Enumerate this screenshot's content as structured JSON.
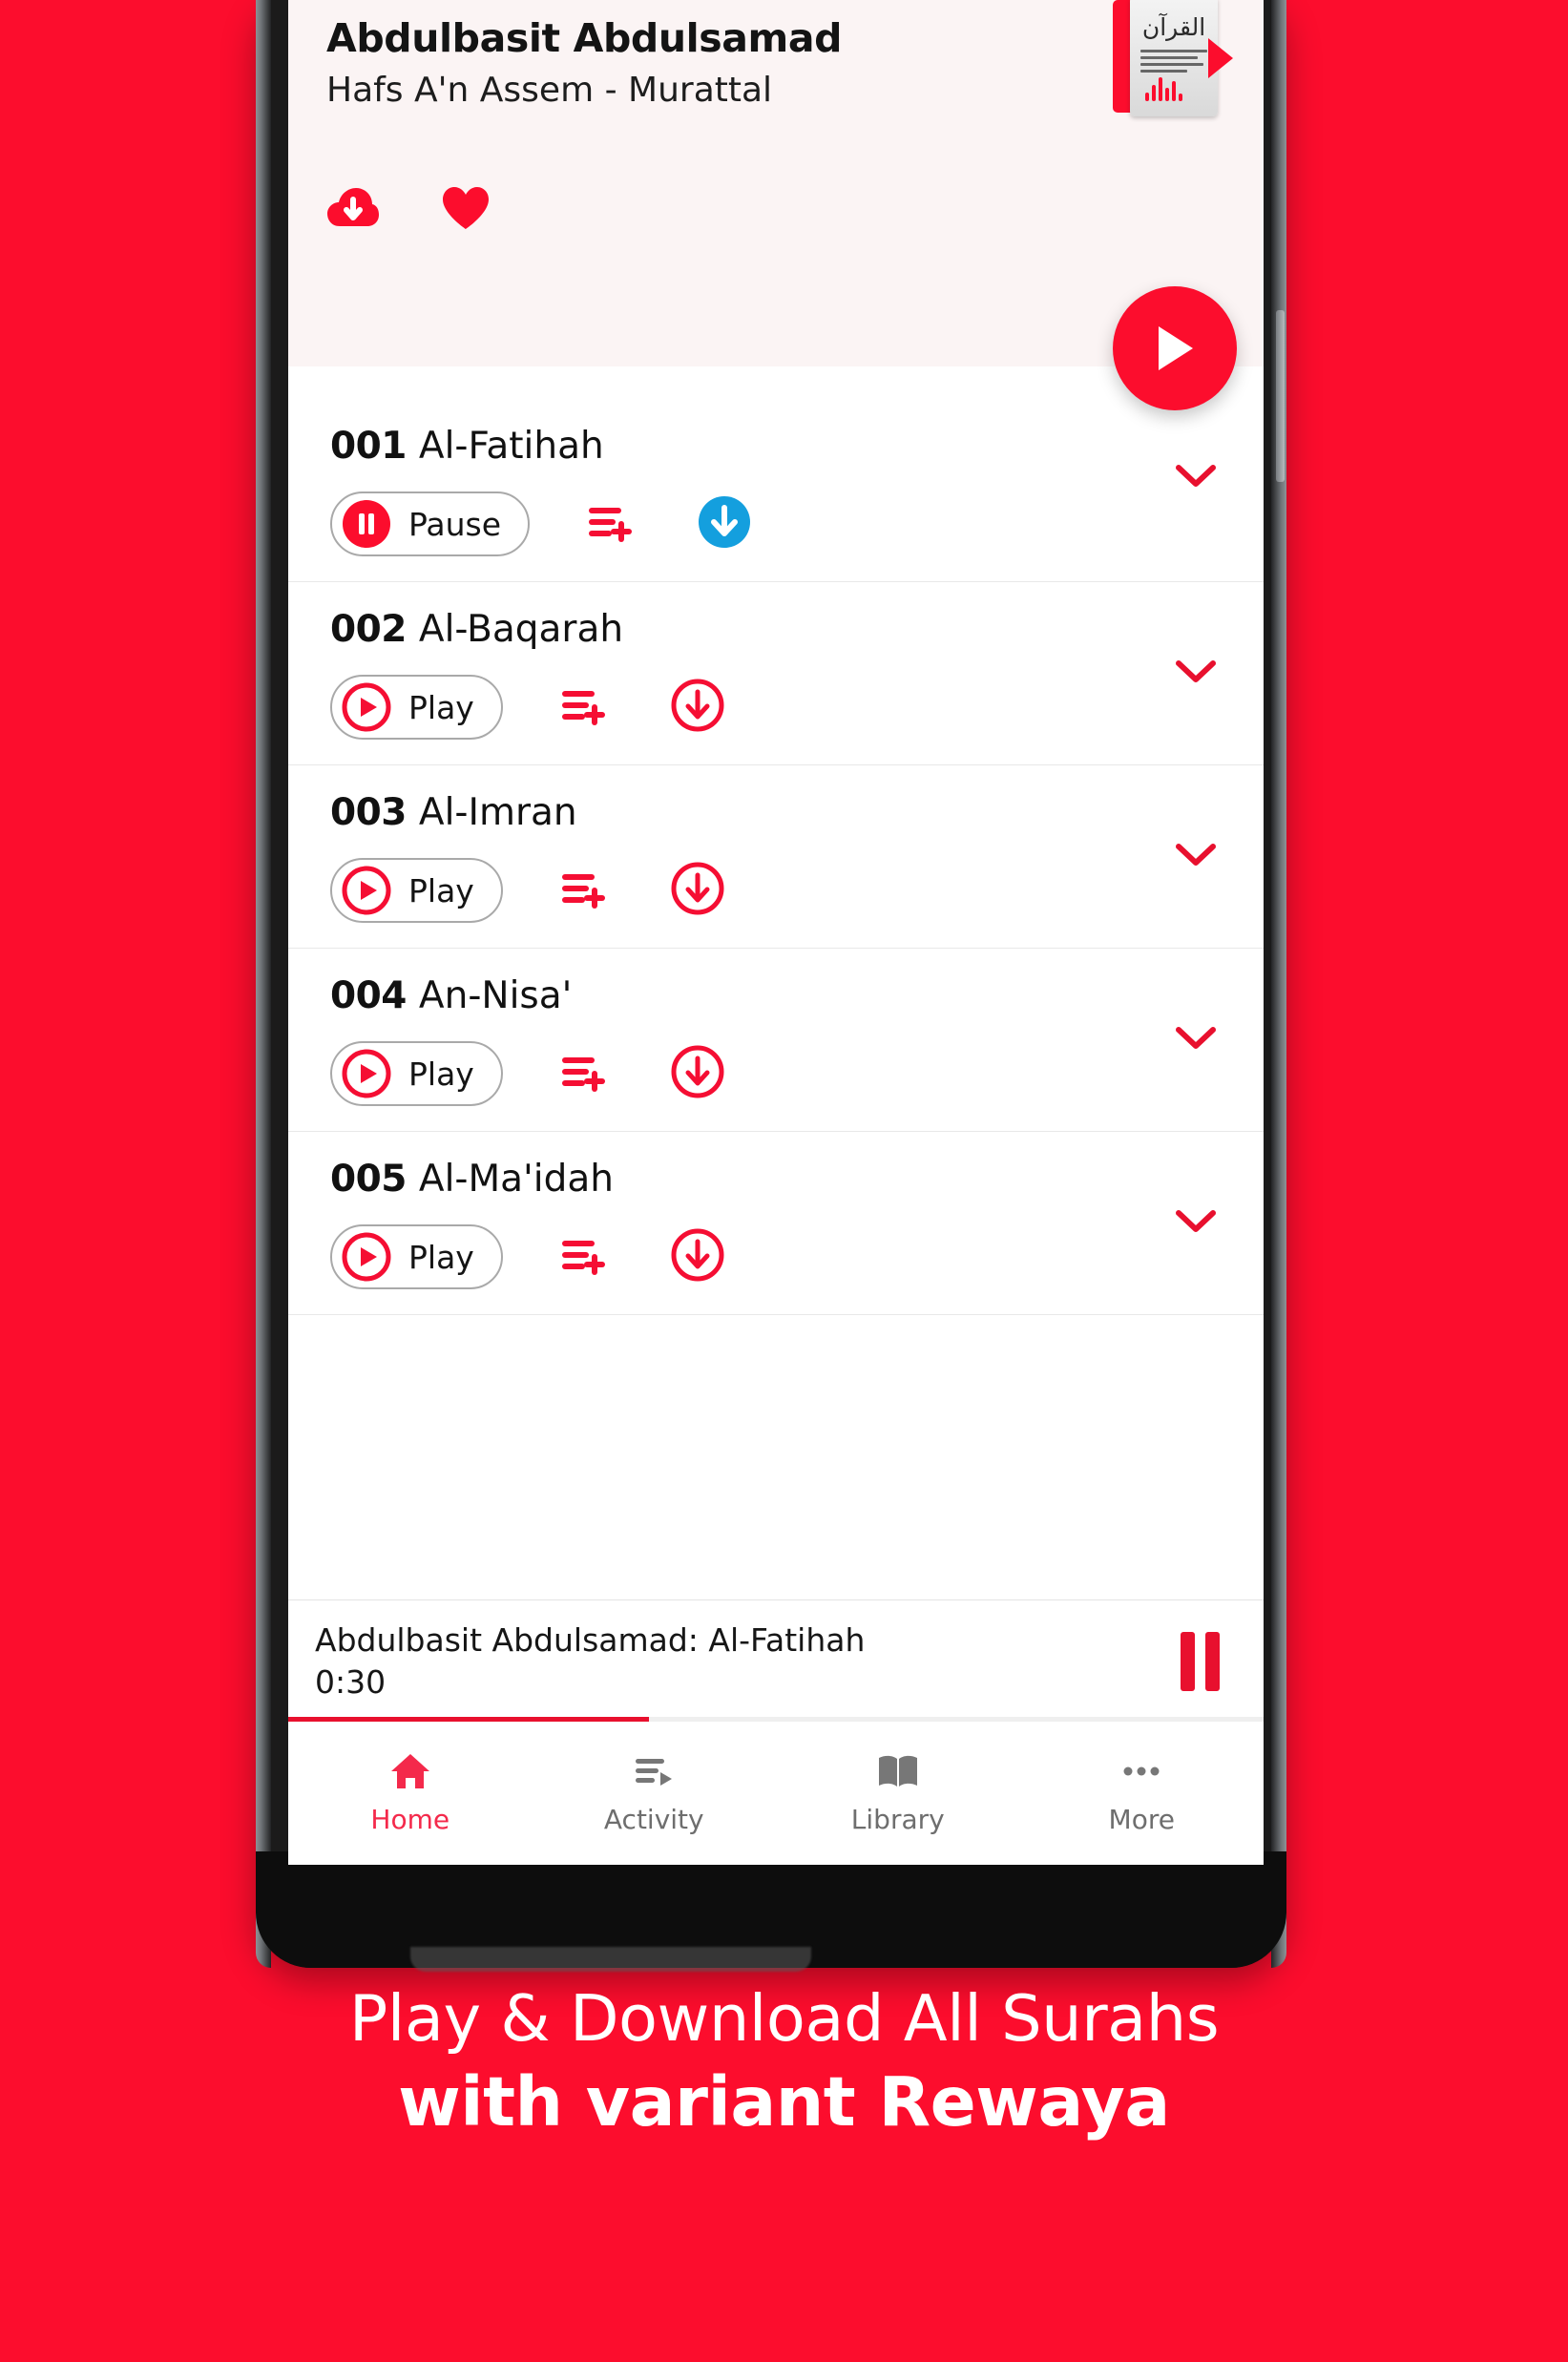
{
  "brand": {
    "red": "#FC0D2D",
    "blue": "#149FDE",
    "dark_red": "#E8102E"
  },
  "header": {
    "reciter_name": "Abdulbasit Abdulsamad",
    "rewaya": "Hafs A'n Assem - Murattal",
    "dropdown_icon": "chevron-down-icon",
    "album_art_icon": "quran-album-art",
    "album_art_text": "القرآن",
    "download_icon": "cloud-download-icon",
    "favorite_icon": "heart-icon",
    "play_icon": "play-icon"
  },
  "surahs": [
    {
      "number": "001",
      "name": "Al-Fatihah",
      "action_label": "Pause",
      "action_icon": "pause-icon",
      "state": "playing",
      "download_style": "filled-blue",
      "playlist_icon": "playlist-add-icon",
      "download_icon": "download-circle-icon",
      "expand_icon": "chevron-down-icon"
    },
    {
      "number": "002",
      "name": "Al-Baqarah",
      "action_label": "Play",
      "action_icon": "play-icon",
      "state": "paused",
      "download_style": "outline-red",
      "playlist_icon": "playlist-add-icon",
      "download_icon": "download-circle-icon",
      "expand_icon": "chevron-down-icon"
    },
    {
      "number": "003",
      "name": "Al-Imran",
      "action_label": "Play",
      "action_icon": "play-icon",
      "state": "paused",
      "download_style": "outline-red",
      "playlist_icon": "playlist-add-icon",
      "download_icon": "download-circle-icon",
      "expand_icon": "chevron-down-icon"
    },
    {
      "number": "004",
      "name": "An-Nisa'",
      "action_label": "Play",
      "action_icon": "play-icon",
      "state": "paused",
      "download_style": "outline-red",
      "playlist_icon": "playlist-add-icon",
      "download_icon": "download-circle-icon",
      "expand_icon": "chevron-down-icon"
    },
    {
      "number": "005",
      "name": "Al-Ma'idah",
      "action_label": "Play",
      "action_icon": "play-icon",
      "state": "paused",
      "download_style": "outline-red",
      "playlist_icon": "playlist-add-icon",
      "download_icon": "download-circle-icon",
      "expand_icon": "chevron-down-icon"
    }
  ],
  "mini_player": {
    "title": "Abdulbasit Abdulsamad: Al-Fatihah",
    "elapsed": "0:30",
    "progress_percent": 37,
    "pause_icon": "pause-icon"
  },
  "bottom_nav": {
    "items": [
      {
        "label": "Home",
        "icon": "home-icon",
        "active": true
      },
      {
        "label": "Activity",
        "icon": "activity-playlist-icon",
        "active": false
      },
      {
        "label": "Library",
        "icon": "book-library-icon",
        "active": false
      },
      {
        "label": "More",
        "icon": "more-dots-icon",
        "active": false
      }
    ]
  },
  "promo": {
    "line1": "Play & Download All Surahs",
    "line2": "with variant Rewaya"
  }
}
